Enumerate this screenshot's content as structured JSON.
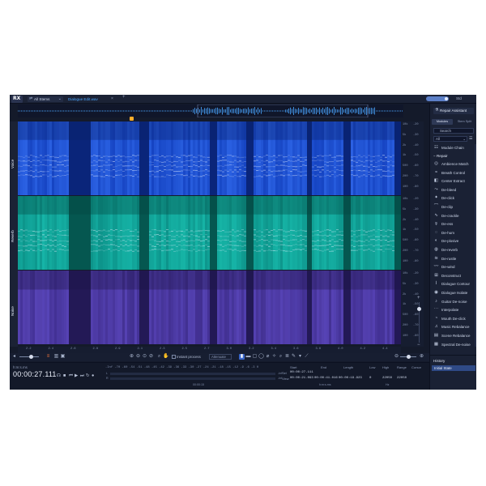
{
  "app": {
    "logo": "RX",
    "stems_dropdown": "All Stems",
    "file_tab": "Dialogue Edit.wav",
    "std_label": "Std"
  },
  "lanes": [
    {
      "label": "Voice",
      "base": "#0f3bb8",
      "hi": "#3e7bff",
      "dark": "#0a1f66"
    },
    {
      "label": "Reverb",
      "base": "#0a8a82",
      "hi": "#1fd1c0",
      "dark": "#04453f"
    },
    {
      "label": "Noise",
      "base": "#3b2a86",
      "hi": "#6a55d6",
      "dark": "#1c1446"
    }
  ],
  "db_scale": {
    "left": [
      "10k",
      "5k",
      "2k",
      "1k",
      "500",
      "200",
      "100"
    ],
    "right": [
      "-20",
      "-30",
      "-40",
      "-50",
      "-60",
      "-70",
      "-80"
    ]
  },
  "time_axis": [
    "2.2",
    "2.4",
    "2.6",
    "2.8",
    "2.9",
    "2.1",
    "2.3",
    "2.5",
    "2.7",
    "3.0",
    "3.2",
    "3.4",
    "3.6",
    "3.8",
    "4.0",
    "4.2",
    "4.4"
  ],
  "toolbar": {
    "instant_process_label": "Instant process",
    "instant_mode": "Attenuate"
  },
  "transport": {
    "time_label": "h:m:s.ms",
    "timecode": "00:00:27.111",
    "meter_scale": "-Inf  -70  -60  -54  -51  -48  -45  -42  -39  -36  -33  -30  -27  -24  -21  -18  -15  -12  -9  -6  -3   0",
    "meter_left": "L",
    "meter_right": "R",
    "meter_left_val": "-Inf",
    "meter_right_val": "-Inf",
    "meter_caption": "00:00:15",
    "selection": {
      "headers": [
        "Start",
        "End",
        "Length",
        "Low",
        "High",
        "Range",
        "Cursor"
      ],
      "sel_label": "Sel",
      "view_label": "View",
      "sel_start": "00:00:27.111",
      "view_start": "00:00:21.093",
      "view_end": "00:00:41.016",
      "view_length": "00:00:19.923",
      "low": "0",
      "high": "22050",
      "range": "22050",
      "time_caption": "h:m:s.ms",
      "hz_caption": "Hz"
    }
  },
  "panel": {
    "repair_assistant": "Repair Assistant",
    "seg_a": "Modules",
    "seg_b": "Stem Split",
    "search_placeholder": "Search",
    "filter": "All",
    "module_chain": "Module Chain",
    "repair_header": "Repair",
    "modules": [
      {
        "label": "Ambience Match",
        "icon": "◎"
      },
      {
        "label": "Breath Control",
        "icon": "≈"
      },
      {
        "label": "Center Extract",
        "icon": "◧"
      },
      {
        "label": "De-bleed",
        "icon": "⤳"
      },
      {
        "label": "De-click",
        "icon": "✦"
      },
      {
        "label": "De-clip",
        "icon": "⌒"
      },
      {
        "label": "De-crackle",
        "icon": "∿"
      },
      {
        "label": "De-ess",
        "icon": "ş"
      },
      {
        "label": "De-hum",
        "icon": "◌"
      },
      {
        "label": "De-plosive",
        "icon": "◐"
      },
      {
        "label": "De-reverb",
        "icon": "◍"
      },
      {
        "label": "De-rustle",
        "icon": "≋"
      },
      {
        "label": "De-wind",
        "icon": "〰"
      },
      {
        "label": "Deconstruct",
        "icon": "⊞"
      },
      {
        "label": "Dialogue Contour",
        "icon": "⌇"
      },
      {
        "label": "Dialogue Isolate",
        "icon": "◉"
      },
      {
        "label": "Guitar De-noise",
        "icon": "♪"
      },
      {
        "label": "Interpolate",
        "icon": "⋯"
      },
      {
        "label": "Mouth De-click",
        "icon": "◔"
      },
      {
        "label": "Music Rebalance",
        "icon": "♫"
      },
      {
        "label": "Scene Rebalance",
        "icon": "▤"
      },
      {
        "label": "Spectral De-noise",
        "icon": "▦"
      }
    ]
  },
  "history": {
    "title": "History",
    "item": "Initial State"
  }
}
